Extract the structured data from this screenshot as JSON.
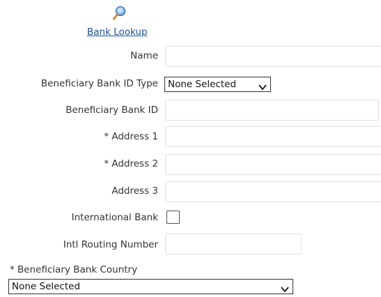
{
  "bank_lookup": {
    "link_label": "Bank Lookup",
    "icon": "magnifier-icon"
  },
  "fields": {
    "name": {
      "label": "Name",
      "value": ""
    },
    "bank_id_type": {
      "label": "Beneficiary Bank ID Type",
      "selected": "None Selected"
    },
    "bank_id": {
      "label": "Beneficiary Bank ID",
      "value": ""
    },
    "address1": {
      "label": "* Address 1",
      "value": ""
    },
    "address2": {
      "label": "* Address 2",
      "value": ""
    },
    "address3": {
      "label": "Address 3",
      "value": ""
    },
    "international_bank": {
      "label": "International Bank",
      "checked": false
    },
    "intl_routing_number": {
      "label": "Intl Routing Number",
      "value": ""
    },
    "bank_country": {
      "label": "* Beneficiary Bank Country",
      "selected": "None Selected"
    }
  },
  "colors": {
    "link": "#1a4f93",
    "label_text": "#333333",
    "input_border": "#e1e1e1",
    "select_border": "#303030"
  }
}
